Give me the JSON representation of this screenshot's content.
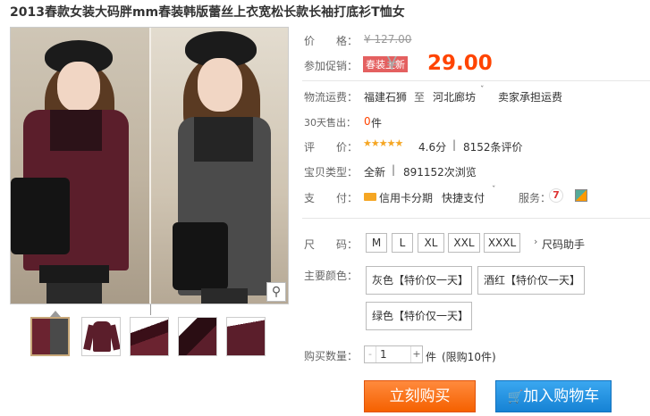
{
  "product": {
    "title": "2013春款女装大码胖mm春装韩版蕾丝上衣宽松长款长袖打底衫T恤女"
  },
  "gallery": {
    "zoom_icon": "magnifier-icon",
    "thumbnails": [
      {
        "name": "model-photo"
      },
      {
        "name": "wine-top-full"
      },
      {
        "name": "wine-detail-1"
      },
      {
        "name": "wine-detail-2"
      },
      {
        "name": "wine-detail-3"
      }
    ]
  },
  "price": {
    "label": "价　　格：",
    "original": "¥ 127.00"
  },
  "promo": {
    "label": "参加促销：",
    "tag": "春装上新",
    "yen": "¥",
    "price": "29.00"
  },
  "shipping": {
    "label": "物流运费：",
    "from": "福建石狮",
    "sep": "至",
    "to": "河北廊坊",
    "fee": "卖家承担运费"
  },
  "sales": {
    "label": "30天售出：",
    "count": "0",
    "unit": "件"
  },
  "rating": {
    "label": "评　　价：",
    "stars": "★★★★★",
    "score": "4.6分",
    "sep": "|",
    "reviews": "8152条评价"
  },
  "item_type": {
    "label": "宝贝类型：",
    "value": "全新",
    "sep": "|",
    "views": "891152次浏览"
  },
  "payment": {
    "label": "支　　付：",
    "installment": "信用卡分期",
    "quick": "快捷支付",
    "service_label": "服务："
  },
  "size": {
    "label": "尺　　码：",
    "options": [
      "M",
      "L",
      "XL",
      "XXL",
      "XXXL"
    ],
    "helper": "尺码助手"
  },
  "color": {
    "label": "主要颜色：",
    "options": [
      "灰色【特价仅一天】",
      "酒红【特价仅一天】",
      "绿色【特价仅一天】"
    ]
  },
  "quantity": {
    "label": "购买数量：",
    "minus": "-",
    "value": "1",
    "plus": "+",
    "unit": "件",
    "limit": "(限购10件)"
  },
  "actions": {
    "buy_now": "立刻购买",
    "add_to_cart": "加入购物车"
  },
  "colors": {
    "accent": "#ff4400",
    "buy_button": "#f56100",
    "cart_button": "#1682d4",
    "promo_tag": "#e46060"
  }
}
